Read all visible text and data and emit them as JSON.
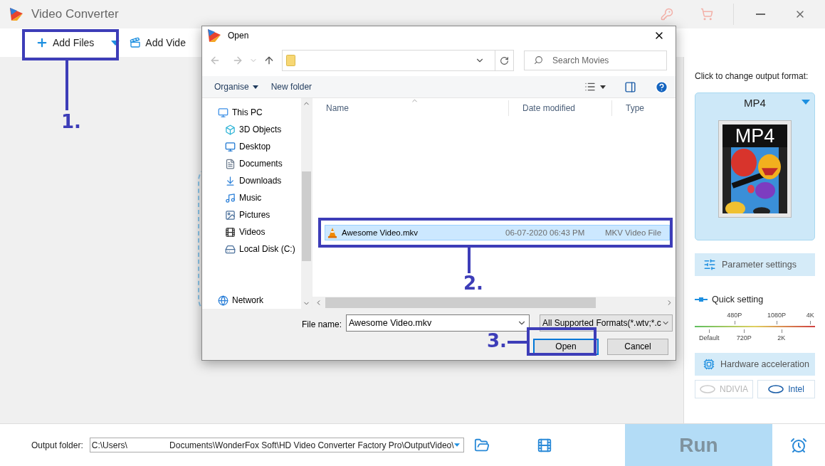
{
  "app": {
    "title": "Video Converter"
  },
  "toolbar": {
    "add_files": "Add Files",
    "add_video": "Add Vide"
  },
  "dialog": {
    "title": "Open",
    "search": {
      "placeholder": "Search Movies"
    },
    "commands": [
      "Organise",
      "New folder"
    ],
    "nav": [
      {
        "label": "This PC",
        "kind": "pc",
        "children": [
          {
            "label": "3D Objects",
            "kind": "cube"
          },
          {
            "label": "Desktop",
            "kind": "desktop"
          },
          {
            "label": "Documents",
            "kind": "documents"
          },
          {
            "label": "Downloads",
            "kind": "downloads"
          },
          {
            "label": "Music",
            "kind": "music"
          },
          {
            "label": "Pictures",
            "kind": "pictures"
          },
          {
            "label": "Videos",
            "kind": "videos"
          },
          {
            "label": "Local Disk (C:)",
            "kind": "disk"
          }
        ]
      },
      {
        "label": "Network",
        "kind": "network"
      }
    ],
    "columns": [
      "Name",
      "Date modified",
      "Type"
    ],
    "files": [
      {
        "name": "Awesome Video.mkv",
        "date": "06-07-2020 06:43 PM",
        "type": "MKV Video File",
        "selected": true
      }
    ],
    "file_name_label": "File name:",
    "file_name": "Awesome Video.mkv",
    "filter": "All Supported Formats(*.wtv;*.c",
    "buttons": [
      {
        "label": "Open",
        "default": true
      },
      {
        "label": "Cancel",
        "default": false
      }
    ]
  },
  "output_panel": {
    "heading": "Click to change output format:",
    "format": "MP4",
    "thumbnail_text": "MP4",
    "parameter_settings": "Parameter settings",
    "quick_setting": "Quick setting",
    "scale_top": [
      "480P",
      "1080P",
      "4K"
    ],
    "scale_bottom": [
      "Default",
      "720P",
      "2K"
    ],
    "hardware_acceleration": "Hardware acceleration",
    "accelerators": [
      {
        "label": "NDIVIA",
        "disabled": true
      },
      {
        "label": "Intel",
        "disabled": false
      }
    ]
  },
  "bottom_bar": {
    "label": "Output folder:",
    "path_start": "C:\\Users\\",
    "path_end": "Documents\\WonderFox Soft\\HD Video Converter Factory Pro\\OutputVideo\\",
    "run": {
      "label": "Run",
      "disabled": true
    }
  },
  "steps": [
    "1.",
    "2.",
    "3."
  ]
}
